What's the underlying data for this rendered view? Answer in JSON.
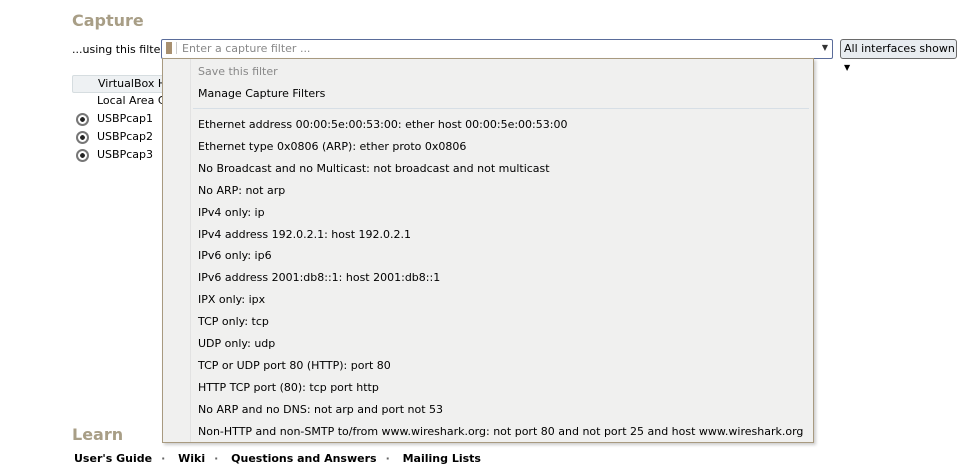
{
  "capture": {
    "heading": "Capture",
    "filter_label": "...using this filter:",
    "filter_placeholder": "Enter a capture filter ...",
    "interfaces_button": "All interfaces shown"
  },
  "interfaces": [
    "VirtualBox Host-Only Network",
    "Local Area Connection",
    "USBPcap1",
    "USBPcap2",
    "USBPcap3"
  ],
  "menu": {
    "save": "Save this filter",
    "manage": "Manage Capture Filters",
    "filters": [
      "Ethernet address 00:00:5e:00:53:00: ether host 00:00:5e:00:53:00",
      "Ethernet type 0x0806 (ARP): ether proto 0x0806",
      "No Broadcast and no Multicast: not broadcast and not multicast",
      "No ARP: not arp",
      "IPv4 only: ip",
      "IPv4 address 192.0.2.1: host 192.0.2.1",
      "IPv6 only: ip6",
      "IPv6 address 2001:db8::1: host 2001:db8::1",
      "IPX only: ipx",
      "TCP only: tcp",
      "UDP only: udp",
      "TCP or UDP port 80 (HTTP): port 80",
      "HTTP TCP port (80): tcp port http",
      "No ARP and no DNS: not arp and port not 53",
      "Non-HTTP and non-SMTP to/from www.wireshark.org: not port 80 and not port 25 and host www.wireshark.org"
    ]
  },
  "learn": {
    "heading": "Learn",
    "links": [
      "User's Guide",
      "Wiki",
      "Questions and Answers",
      "Mailing Lists"
    ],
    "separator": "·"
  }
}
